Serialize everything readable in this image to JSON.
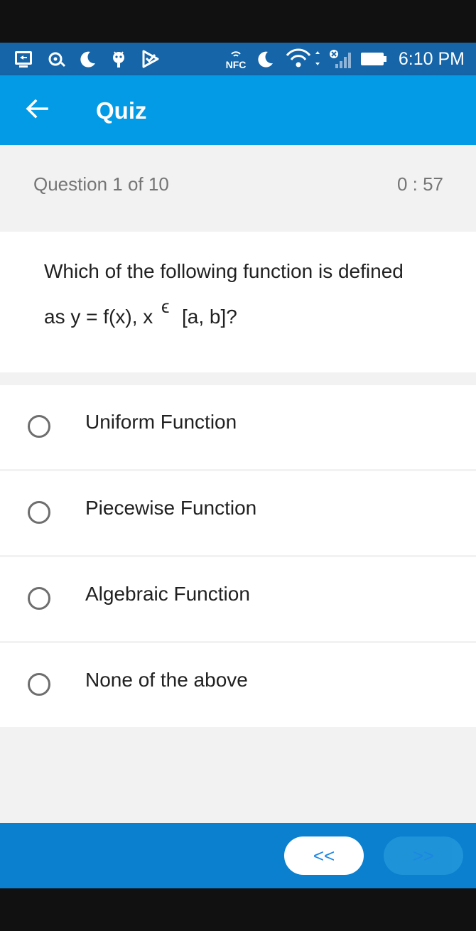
{
  "status_bar": {
    "time": "6:10 PM",
    "nfc_label": "NFC",
    "icons": [
      "screen-cast-icon",
      "settings-icon",
      "moon-icon",
      "robot-icon",
      "play-store-icon",
      "nfc-icon",
      "moon-icon",
      "wifi-icon",
      "signal-icon",
      "battery-icon"
    ],
    "color": "#1565a8"
  },
  "app_bar": {
    "title": "Quiz",
    "back_icon": "arrow-left-icon",
    "color": "#039be5"
  },
  "quiz": {
    "counter": "Question 1 of  10",
    "timer": "0 : 57",
    "question": {
      "line1": "Which of the following function is defined",
      "line2": "as y = f(x), x",
      "symbol": "ϵ",
      "line3": "[a, b]?"
    },
    "options": [
      {
        "label": "Uniform Function"
      },
      {
        "label": "Piecewise Function"
      },
      {
        "label": "Algebraic Function"
      },
      {
        "label": "None of the above"
      }
    ]
  },
  "navigation": {
    "prev_label": "<<",
    "next_label": ">>",
    "color": "#0a80cf"
  }
}
